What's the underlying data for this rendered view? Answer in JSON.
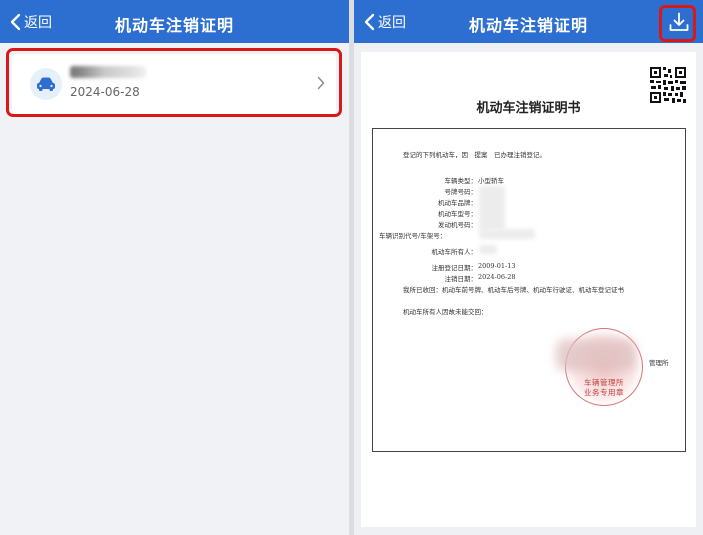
{
  "left": {
    "nav": {
      "back_label": "返回",
      "title": "机动车注销证明"
    },
    "record": {
      "date": "2024-06-28"
    }
  },
  "right": {
    "nav": {
      "back_label": "返回",
      "title": "机动车注销证明"
    },
    "certificate": {
      "title": "机动车注销证明书",
      "intro": "登记的下列机动车，因　提案　已办理注销登记。",
      "fields": {
        "vehicle_type_label": "车辆类型：",
        "vehicle_type_value": "小型轿车",
        "plate_label": "号牌号码：",
        "brand_label": "机动车品牌：",
        "model_label": "机动车型号：",
        "engine_label": "发动机号码：",
        "vin_label": "车辆识别代号/车架号：",
        "owner_label": "机动车所有人：",
        "reg_date_label": "注册登记日期：",
        "reg_date_value": "2009-01-13",
        "cancel_date_label": "注销日期：",
        "cancel_date_value": "2024-06-28",
        "recovered": "我所已收回：机动车前号牌、机动车后号牌、机动车行驶证、机动车登记证书",
        "owner_note": "机动车所有人因故未能交回："
      },
      "office_suffix": "管理所",
      "stamp_line1": "车辆管理所",
      "stamp_line2": "业务专用章"
    }
  },
  "colors": {
    "nav_blue": "#2d6fd0",
    "highlight_red": "#d91818",
    "stamp_red": "#c24040"
  }
}
